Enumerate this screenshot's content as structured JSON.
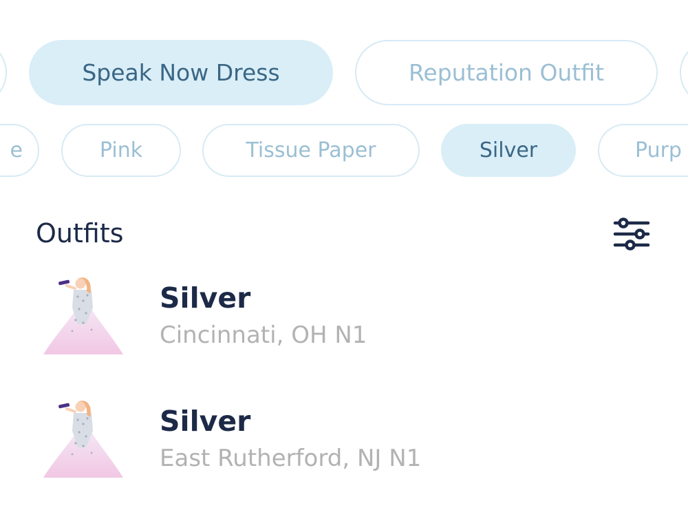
{
  "era_filters": {
    "items": [
      {
        "label": "",
        "selected": false
      },
      {
        "label": "Speak Now Dress",
        "selected": true
      },
      {
        "label": "Reputation Outfit",
        "selected": false
      },
      {
        "label": "",
        "selected": false
      }
    ]
  },
  "color_filters": {
    "items": [
      {
        "label": "e",
        "selected": false
      },
      {
        "label": "Pink",
        "selected": false
      },
      {
        "label": "Tissue Paper",
        "selected": false
      },
      {
        "label": "Silver",
        "selected": true
      },
      {
        "label": "Purp",
        "selected": false
      }
    ]
  },
  "outfits": {
    "title": "Outfits",
    "filter_icon": "sliders-icon",
    "items": [
      {
        "name": "Silver",
        "location": "Cincinnati, OH N1",
        "thumbnail_icon": "gown-figure-icon"
      },
      {
        "name": "Silver",
        "location": "East Rutherford, NJ N1",
        "thumbnail_icon": "gown-figure-icon"
      }
    ]
  },
  "colors": {
    "chip_selected_bg": "#d9eef7",
    "chip_selected_text": "#3b6685",
    "chip_text": "#9bbfd4",
    "chip_border": "#d6eaf4",
    "title_text": "#1c2a47",
    "subtitle_text": "#b2b2b2"
  }
}
